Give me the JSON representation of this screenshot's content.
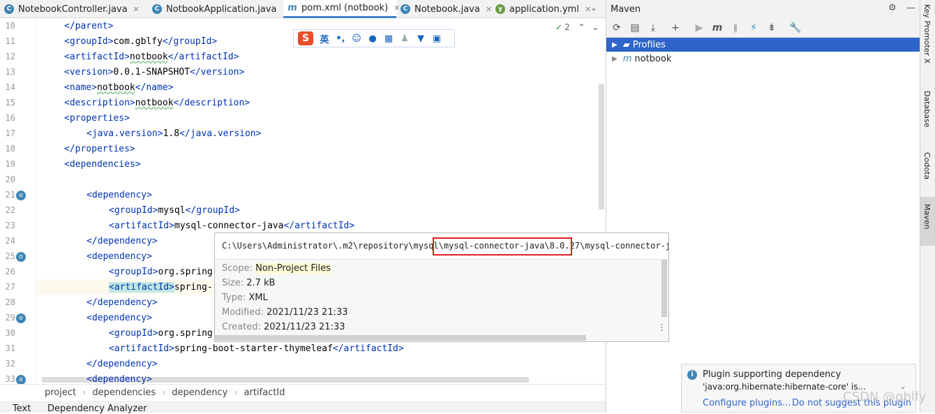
{
  "tabs": [
    {
      "label": "NotebookController.java",
      "icon": "class-icon",
      "active": false
    },
    {
      "label": "NotbookApplication.java",
      "icon": "class-icon",
      "active": false
    },
    {
      "label": "pom.xml (notbook)",
      "icon": "maven-icon",
      "active": true
    },
    {
      "label": "Notebook.java",
      "icon": "class-icon",
      "active": false
    },
    {
      "label": "application.yml",
      "icon": "yaml-icon",
      "active": false
    }
  ],
  "editor": {
    "inspection_count": "2",
    "lines": [
      {
        "num": "10",
        "indent": 0,
        "open": "</parent>",
        "text": "",
        "close": ""
      },
      {
        "num": "11",
        "indent": 0,
        "open": "<groupId>",
        "text": "com.gblfy",
        "close": "</groupId>"
      },
      {
        "num": "12",
        "indent": 0,
        "open": "<artifactId>",
        "text": "notbook",
        "close": "</artifactId>"
      },
      {
        "num": "13",
        "indent": 0,
        "open": "<version>",
        "text": "0.0.1-SNAPSHOT",
        "close": "</version>"
      },
      {
        "num": "14",
        "indent": 0,
        "open": "<name>",
        "text": "notbook",
        "close": "</name>"
      },
      {
        "num": "15",
        "indent": 0,
        "open": "<description>",
        "text": "notbook",
        "close": "</description>"
      },
      {
        "num": "16",
        "indent": 0,
        "open": "<properties>",
        "text": "",
        "close": ""
      },
      {
        "num": "17",
        "indent": 1,
        "open": "<java.version>",
        "text": "1.8",
        "close": "</java.version>"
      },
      {
        "num": "18",
        "indent": 0,
        "open": "</properties>",
        "text": "",
        "close": ""
      },
      {
        "num": "19",
        "indent": 0,
        "open": "<dependencies>",
        "text": "",
        "close": ""
      },
      {
        "num": "20",
        "indent": 0,
        "open": "",
        "text": "",
        "close": ""
      },
      {
        "num": "21",
        "indent": 1,
        "open": "<dependency>",
        "text": "",
        "close": ""
      },
      {
        "num": "22",
        "indent": 2,
        "open": "<groupId>",
        "text": "mysql",
        "close": "</groupId>"
      },
      {
        "num": "23",
        "indent": 2,
        "open": "<artifactId>",
        "text": "mysql-connector-java",
        "close": "</artifactId>"
      },
      {
        "num": "24",
        "indent": 1,
        "open": "</dependency>",
        "text": "",
        "close": ""
      },
      {
        "num": "25",
        "indent": 1,
        "open": "<dependency>",
        "text": "",
        "close": ""
      },
      {
        "num": "26",
        "indent": 2,
        "open": "<groupId>",
        "text": "org.spring",
        "close": ""
      },
      {
        "num": "27",
        "indent": 2,
        "open": "<artifactId>",
        "text": "spring-",
        "close": ""
      },
      {
        "num": "28",
        "indent": 1,
        "open": "</dependency>",
        "text": "",
        "close": ""
      },
      {
        "num": "29",
        "indent": 1,
        "open": "<dependency>",
        "text": "",
        "close": ""
      },
      {
        "num": "30",
        "indent": 2,
        "open": "<groupId>",
        "text": "org.spring",
        "close": ""
      },
      {
        "num": "31",
        "indent": 2,
        "open": "<artifactId>",
        "text": "spring-boot-starter-thymeleaf",
        "close": "</artifactId>"
      },
      {
        "num": "32",
        "indent": 1,
        "open": "</dependency>",
        "text": "",
        "close": ""
      },
      {
        "num": "33",
        "indent": 1,
        "open": "<dependency>",
        "text": "",
        "close": ""
      }
    ]
  },
  "breadcrumb": [
    "project",
    "dependencies",
    "dependency",
    "artifactId"
  ],
  "bottom_tabs": [
    "Text",
    "Dependency Analyzer"
  ],
  "popup": {
    "path_before": "C:\\Users\\Administrator\\.m2\\repository\\mysql\\",
    "path_highlight": "mysql-connector-java\\8.0.27",
    "path_after": "\\mysql-connector-java",
    "scope_label": "Scope:",
    "scope_value": "Non-Project Files",
    "size_label": "Size:",
    "size_value": "2.7 kB",
    "type_label": "Type:",
    "type_value": "XML",
    "modified_label": "Modified:",
    "modified_value": "2021/11/23 21:33",
    "created_label": "Created:",
    "created_value": "2021/11/23 21:33"
  },
  "maven": {
    "title": "Maven",
    "tree": [
      {
        "label": "Profiles",
        "selected": true
      },
      {
        "label": "notbook",
        "selected": false
      }
    ]
  },
  "right_tools": [
    "Key Promoter X",
    "Database",
    "Codota",
    "Maven"
  ],
  "notification": {
    "title": "Plugin supporting dependency",
    "body": "'java:org.hibernate:hibernate-core' is...",
    "link1": "Configure plugins...",
    "link2": "Do not suggest this plugin"
  },
  "ime": {
    "lang": "英"
  },
  "watermark": "CSDN @gblfy",
  "colors": {
    "accent": "#4083c9",
    "tag": "#0033b3",
    "selection": "#2f65ca",
    "highlight_box": "#e02020"
  }
}
